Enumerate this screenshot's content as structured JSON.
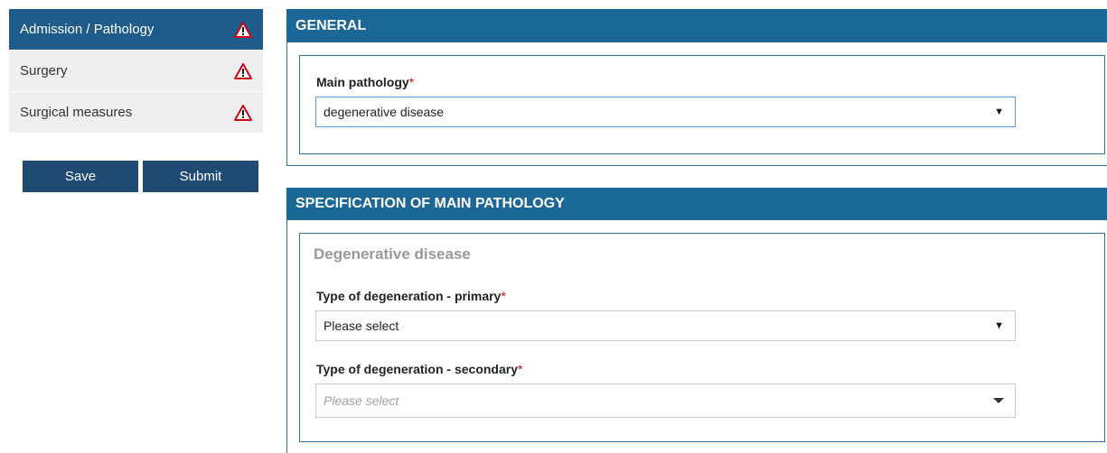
{
  "sidebar": {
    "items": [
      {
        "label": "Admission / Pathology",
        "icon": "warning-icon",
        "active": true
      },
      {
        "label": "Surgery",
        "icon": "warning-icon",
        "active": false
      },
      {
        "label": "Surgical measures",
        "icon": "warning-icon",
        "active": false
      }
    ],
    "save_label": "Save",
    "submit_label": "Submit"
  },
  "general": {
    "title": "GENERAL",
    "main_pathology_label": "Main pathology",
    "required_mark": "*",
    "main_pathology_value": "degenerative disease"
  },
  "specification": {
    "title": "SPECIFICATION OF MAIN PATHOLOGY",
    "subheading": "Degenerative disease",
    "primary_label": "Type of degeneration - primary",
    "primary_value": "Please select",
    "secondary_label": "Type of degeneration - secondary",
    "secondary_placeholder": "Please select"
  },
  "colors": {
    "header_blue": "#1b6797",
    "active_nav": "#1f5c8b",
    "button_blue": "#1f4a74",
    "required_red": "#d0021b",
    "warning_red": "#d0021b"
  }
}
